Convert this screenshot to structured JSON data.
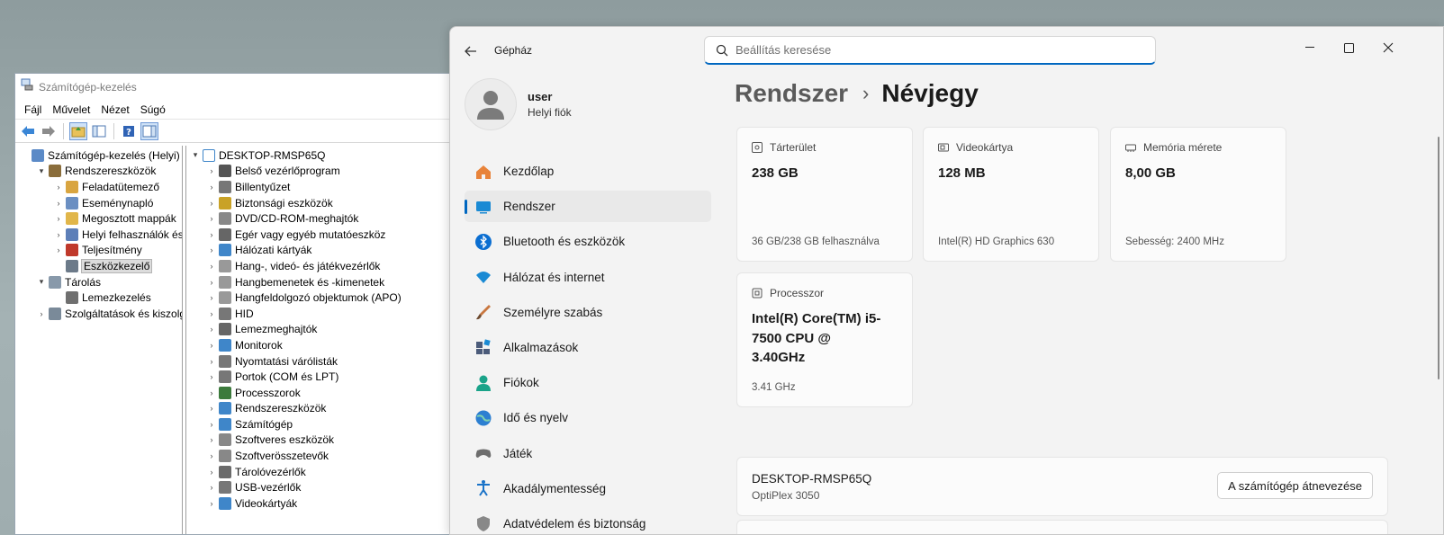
{
  "mmc": {
    "title": "Számítógép-kezelés",
    "menu": [
      "Fájl",
      "Művelet",
      "Nézet",
      "Súgó"
    ],
    "tree": [
      {
        "label": "Számítógép-kezelés (Helyi)",
        "level": 0,
        "expander": "",
        "icon": "computer-mgmt-icon",
        "color": "#5b8ac7"
      },
      {
        "label": "Rendszereszközök",
        "level": 1,
        "expander": "▾",
        "icon": "tools-icon",
        "color": "#8a6d3b"
      },
      {
        "label": "Feladatütemező",
        "level": 2,
        "expander": "›",
        "icon": "clock-icon",
        "color": "#d9a540"
      },
      {
        "label": "Eseménynapló",
        "level": 2,
        "expander": "›",
        "icon": "event-log-icon",
        "color": "#6b8fc2"
      },
      {
        "label": "Megosztott mappák",
        "level": 2,
        "expander": "›",
        "icon": "shared-folder-icon",
        "color": "#e1b64a"
      },
      {
        "label": "Helyi felhasználók és cs",
        "level": 2,
        "expander": "›",
        "icon": "users-icon",
        "color": "#5d7fb8"
      },
      {
        "label": "Teljesítmény",
        "level": 2,
        "expander": "›",
        "icon": "performance-icon",
        "color": "#c0392b"
      },
      {
        "label": "Eszközkezelő",
        "level": 2,
        "expander": "",
        "icon": "device-manager-icon",
        "color": "#6c7a89",
        "selected": true
      },
      {
        "label": "Tárolás",
        "level": 1,
        "expander": "▾",
        "icon": "storage-icon",
        "color": "#8899aa"
      },
      {
        "label": "Lemezkezelés",
        "level": 2,
        "expander": "",
        "icon": "disk-mgmt-icon",
        "color": "#6f6f6f"
      },
      {
        "label": "Szolgáltatások és kiszolgáló",
        "level": 1,
        "expander": "›",
        "icon": "services-icon",
        "color": "#7a8a99"
      }
    ],
    "devices_root": "DESKTOP-RMSP65Q",
    "devices": [
      {
        "label": "Belső vezérlőprogram",
        "icon": "firmware-icon",
        "color": "#555"
      },
      {
        "label": "Billentyűzet",
        "icon": "keyboard-icon",
        "color": "#777"
      },
      {
        "label": "Biztonsági eszközök",
        "icon": "security-device-icon",
        "color": "#c9a227"
      },
      {
        "label": "DVD/CD-ROM-meghajtók",
        "icon": "dvd-icon",
        "color": "#888"
      },
      {
        "label": "Egér vagy egyéb mutatóeszköz",
        "icon": "mouse-icon",
        "color": "#666"
      },
      {
        "label": "Hálózati kártyák",
        "icon": "network-card-icon",
        "color": "#3f86c9"
      },
      {
        "label": "Hang-, videó- és játékvezérlők",
        "icon": "sound-icon",
        "color": "#999"
      },
      {
        "label": "Hangbemenetek és -kimenetek",
        "icon": "audio-io-icon",
        "color": "#999"
      },
      {
        "label": "Hangfeldolgozó objektumok (APO)",
        "icon": "apo-icon",
        "color": "#999"
      },
      {
        "label": "HID",
        "icon": "hid-icon",
        "color": "#777"
      },
      {
        "label": "Lemezmeghajtók",
        "icon": "disk-drive-icon",
        "color": "#666"
      },
      {
        "label": "Monitorok",
        "icon": "monitor-icon",
        "color": "#3f86c9"
      },
      {
        "label": "Nyomtatási várólisták",
        "icon": "printer-icon",
        "color": "#777"
      },
      {
        "label": "Portok (COM és LPT)",
        "icon": "port-icon",
        "color": "#777"
      },
      {
        "label": "Processzorok",
        "icon": "processor-icon",
        "color": "#3c7a3c"
      },
      {
        "label": "Rendszereszközök",
        "icon": "system-device-icon",
        "color": "#3f86c9"
      },
      {
        "label": "Számítógép",
        "icon": "computer-icon",
        "color": "#3f86c9"
      },
      {
        "label": "Szoftveres eszközök",
        "icon": "software-device-icon",
        "color": "#888"
      },
      {
        "label": "Szoftverösszetevők",
        "icon": "software-component-icon",
        "color": "#888"
      },
      {
        "label": "Tárolóvezérlők",
        "icon": "storage-controller-icon",
        "color": "#6b6b6b"
      },
      {
        "label": "USB-vezérlők",
        "icon": "usb-icon",
        "color": "#777"
      },
      {
        "label": "Videokártyák",
        "icon": "video-card-icon",
        "color": "#3f86c9"
      }
    ]
  },
  "settings": {
    "app_title": "Gépház",
    "search_placeholder": "Beállítás keresése",
    "profile": {
      "name": "user",
      "account": "Helyi fiók"
    },
    "nav": [
      {
        "label": "Kezdőlap",
        "icon": "home-icon",
        "color": "#e67e22"
      },
      {
        "label": "Rendszer",
        "icon": "system-icon",
        "color": "#0078d4",
        "active": true
      },
      {
        "label": "Bluetooth és eszközök",
        "icon": "bluetooth-icon",
        "color": "#0078d4"
      },
      {
        "label": "Hálózat és internet",
        "icon": "wifi-icon",
        "color": "#0078d4"
      },
      {
        "label": "Személyre szabás",
        "icon": "brush-icon",
        "color": "#c0653a"
      },
      {
        "label": "Alkalmazások",
        "icon": "apps-icon",
        "color": "#4a5a78"
      },
      {
        "label": "Fiókok",
        "icon": "account-icon",
        "color": "#1aa389"
      },
      {
        "label": "Idő és nyelv",
        "icon": "globe-icon",
        "color": "#2c7fd1"
      },
      {
        "label": "Játék",
        "icon": "gamepad-icon",
        "color": "#6d6d6d"
      },
      {
        "label": "Akadálymentesség",
        "icon": "accessibility-icon",
        "color": "#1a73c8"
      },
      {
        "label": "Adatvédelem és biztonság",
        "icon": "shield-icon",
        "color": "#777"
      }
    ],
    "breadcrumb": {
      "parent": "Rendszer",
      "current": "Névjegy"
    },
    "cards": {
      "storage": {
        "title": "Tárterület",
        "value": "238 GB",
        "foot": "36 GB/238 GB felhasználva"
      },
      "video": {
        "title": "Videokártya",
        "value": "128 MB",
        "foot": "Intel(R) HD Graphics 630"
      },
      "memory": {
        "title": "Memória mérete",
        "value": "8,00 GB",
        "foot": "Sebesség: 2400 MHz"
      },
      "cpu": {
        "title": "Processzor",
        "value": "Intel(R) Core(TM) i5-7500 CPU @ 3.40GHz",
        "foot": "3.41 GHz"
      }
    },
    "device": {
      "name": "DESKTOP-RMSP65Q",
      "model": "OptiPlex 3050",
      "rename_label": "A számítógép átnevezése"
    }
  }
}
